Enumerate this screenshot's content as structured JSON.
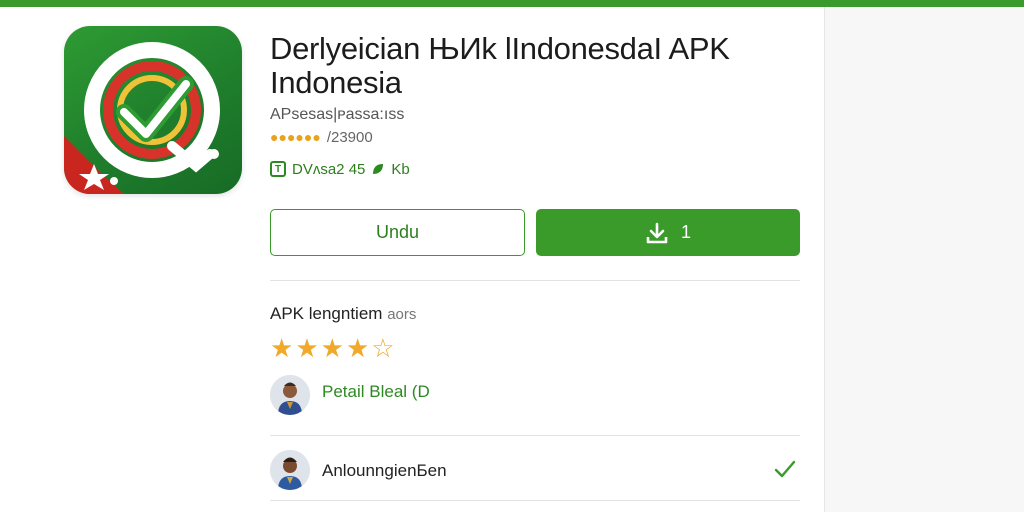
{
  "app": {
    "title_line1": "Derlyeician ЊИk lIndonesdaI APK",
    "title_line2": "Indonesia",
    "subtitle": "APsesas|ᴘassa:ıss",
    "rating_count": "/23900",
    "info_text": "DVʌsa2 45",
    "info_suffix": "Kb"
  },
  "buttons": {
    "secondary_label": "Undu",
    "primary_label": "1"
  },
  "ratings_section": {
    "title": "APK lengntiem",
    "title_suffix": "aors",
    "stars_filled": 4,
    "stars_total": 5
  },
  "reviews": [
    {
      "name": "Petail Bleal",
      "badge": "(D",
      "highlight": true
    },
    {
      "name": "AnlounngienБen",
      "highlight": false
    }
  ],
  "colors": {
    "brand_green": "#3a9a2a",
    "star": "#f0a92a"
  }
}
